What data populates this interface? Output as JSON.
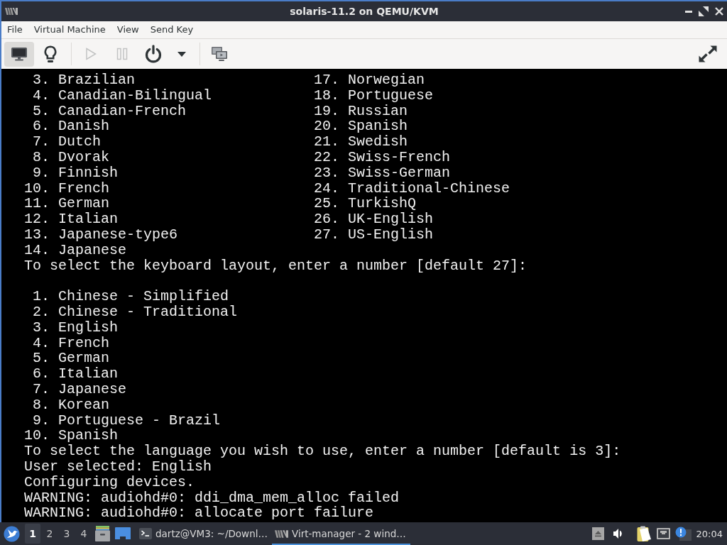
{
  "window": {
    "title": "solaris-11.2 on QEMU/KVM"
  },
  "menu_bar": {
    "items": [
      "File",
      "Virtual Machine",
      "View",
      "Send Key"
    ]
  },
  "toolbar": {
    "view_buttons": [
      {
        "kind": "console",
        "selected": true
      },
      {
        "kind": "details",
        "selected": false
      }
    ],
    "vm_buttons": [
      {
        "kind": "run",
        "disabled": true
      },
      {
        "kind": "pause",
        "disabled": true
      },
      {
        "kind": "shutdown",
        "disabled": false
      },
      {
        "kind": "shutdown-menu",
        "disabled": false
      }
    ]
  },
  "terminal": {
    "keyboard_layouts": {
      "columns": [
        [
          {
            "number": "3.",
            "name": "Brazilian"
          },
          {
            "number": "4.",
            "name": "Canadian-Bilingual"
          },
          {
            "number": "5.",
            "name": "Canadian-French"
          },
          {
            "number": "6.",
            "name": "Danish"
          },
          {
            "number": "7.",
            "name": "Dutch"
          },
          {
            "number": "8.",
            "name": "Dvorak"
          },
          {
            "number": "9.",
            "name": "Finnish"
          },
          {
            "number": "10.",
            "name": "French"
          },
          {
            "number": "11.",
            "name": "German"
          },
          {
            "number": "12.",
            "name": "Italian"
          },
          {
            "number": "13.",
            "name": "Japanese-type6"
          },
          {
            "number": "14.",
            "name": "Japanese"
          }
        ],
        [
          {
            "number": "17.",
            "name": "Norwegian"
          },
          {
            "number": "18.",
            "name": "Portuguese"
          },
          {
            "number": "19.",
            "name": "Russian"
          },
          {
            "number": "20.",
            "name": "Spanish"
          },
          {
            "number": "21.",
            "name": "Swedish"
          },
          {
            "number": "22.",
            "name": "Swiss-French"
          },
          {
            "number": "23.",
            "name": "Swiss-German"
          },
          {
            "number": "24.",
            "name": "Traditional-Chinese"
          },
          {
            "number": "25.",
            "name": "TurkishQ"
          },
          {
            "number": "26.",
            "name": "UK-English"
          },
          {
            "number": "27.",
            "name": "US-English"
          }
        ]
      ]
    },
    "keyboard_prompt": "To select the keyboard layout, enter a number [default 27]:",
    "languages": [
      {
        "number": "1.",
        "name": "Chinese - Simplified"
      },
      {
        "number": "2.",
        "name": "Chinese - Traditional"
      },
      {
        "number": "3.",
        "name": "English"
      },
      {
        "number": "4.",
        "name": "French"
      },
      {
        "number": "5.",
        "name": "German"
      },
      {
        "number": "6.",
        "name": "Italian"
      },
      {
        "number": "7.",
        "name": "Japanese"
      },
      {
        "number": "8.",
        "name": "Korean"
      },
      {
        "number": "9.",
        "name": "Portuguese - Brazil"
      },
      {
        "number": "10.",
        "name": "Spanish"
      }
    ],
    "language_prompt": "To select the language you wish to use, enter a number [default is 3]:",
    "output": [
      "User selected: English",
      "Configuring devices.",
      "WARNING: audiohd#0: ddi_dma_mem_alloc failed",
      "WARNING: audiohd#0: allocate port failure"
    ]
  },
  "taskbar": {
    "workspaces": [
      {
        "label": "1",
        "selected": true
      },
      {
        "label": "2",
        "selected": false
      },
      {
        "label": "3",
        "selected": false
      },
      {
        "label": "4",
        "selected": false
      }
    ],
    "tasks": [
      {
        "kind": "terminal",
        "label": "dartz@VM3: ~/Downl…",
        "selected": false
      },
      {
        "kind": "virt-manager",
        "label": "Virt-manager - 2 wind…",
        "selected": true
      }
    ],
    "clock": "20:04"
  }
}
